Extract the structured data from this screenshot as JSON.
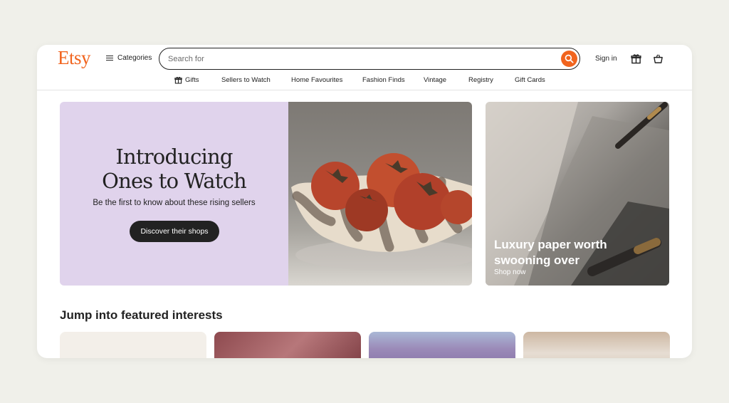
{
  "header": {
    "logo": "Etsy",
    "categories_label": "Categories",
    "search_placeholder": "Search for",
    "sign_in": "Sign in"
  },
  "nav": {
    "items": [
      {
        "label": "Gifts",
        "icon": "gift-icon"
      },
      {
        "label": "Sellers to Watch"
      },
      {
        "label": "Home Favourites"
      },
      {
        "label": "Fashion Finds"
      },
      {
        "label": "Vintage"
      },
      {
        "label": "Registry"
      },
      {
        "label": "Gift Cards"
      }
    ]
  },
  "hero": {
    "title_line1": "Introducing",
    "title_line2": "Ones to Watch",
    "subtitle": "Be the first to know about these rising sellers",
    "cta": "Discover their shops"
  },
  "side_promo": {
    "title_line1": "Luxury paper worth",
    "title_line2": "swooning over",
    "link": "Shop now"
  },
  "featured": {
    "title": "Jump into featured interests"
  },
  "colors": {
    "brand": "#f1641e",
    "hero_bg": "#e0d3ec",
    "button_dark": "#222222"
  }
}
